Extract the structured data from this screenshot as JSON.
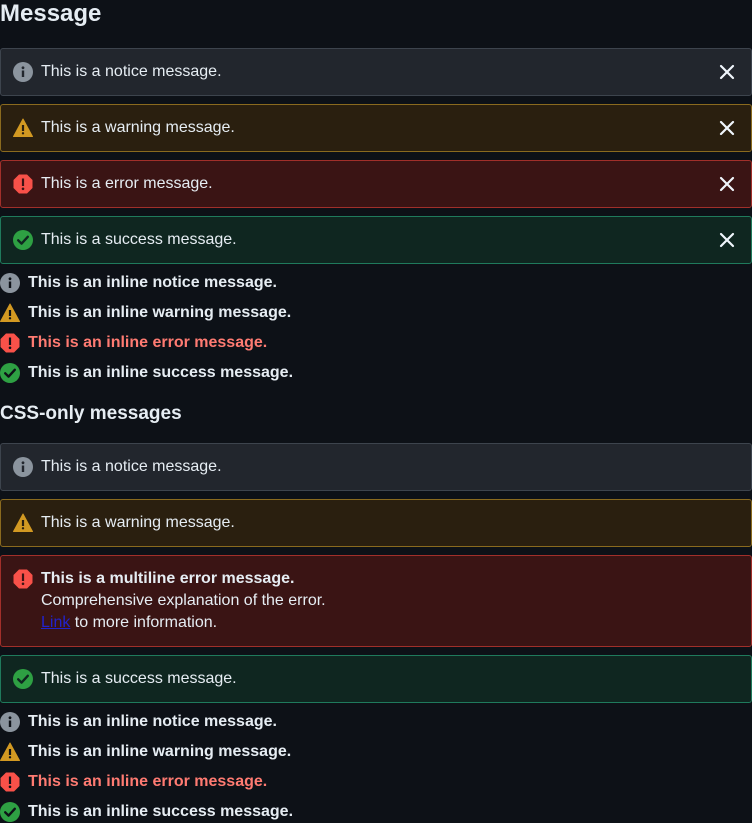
{
  "title": "Message",
  "closable_messages": [
    {
      "type": "notice",
      "text": "This is a notice message."
    },
    {
      "type": "warning",
      "text": "This is a warning message."
    },
    {
      "type": "error",
      "text": "This is a error message."
    },
    {
      "type": "success",
      "text": "This is a success message."
    }
  ],
  "inline_messages": [
    {
      "type": "notice",
      "text": "This is an inline notice message."
    },
    {
      "type": "warning",
      "text": "This is an inline warning message."
    },
    {
      "type": "error",
      "text": "This is an inline error message."
    },
    {
      "type": "success",
      "text": "This is an inline success message."
    }
  ],
  "css_only_title": "CSS-only messages",
  "css_only_messages": {
    "notice": "This is a notice message.",
    "warning": "This is a warning message.",
    "error_title": "This is a multiline error message.",
    "error_line2": "Comprehensive explanation of the error.",
    "error_link": "Link",
    "error_line3_rest": " to more information.",
    "success": "This is a success message."
  },
  "css_only_inline_messages": [
    {
      "type": "notice",
      "text": "This is an inline notice message."
    },
    {
      "type": "warning",
      "text": "This is an inline warning message."
    },
    {
      "type": "error",
      "text": "This is an inline error message."
    },
    {
      "type": "success",
      "text": "This is an inline success message."
    }
  ],
  "colors": {
    "notice_icon": "#8b949e",
    "warning_icon": "#d29922",
    "error_icon": "#f85149",
    "success_icon": "#2ea043",
    "error_text": "#ff7b72"
  },
  "icons": {
    "notice": "info-icon",
    "warning": "warning-icon",
    "error": "error-icon",
    "success": "check-circle-icon",
    "close": "close-icon"
  }
}
